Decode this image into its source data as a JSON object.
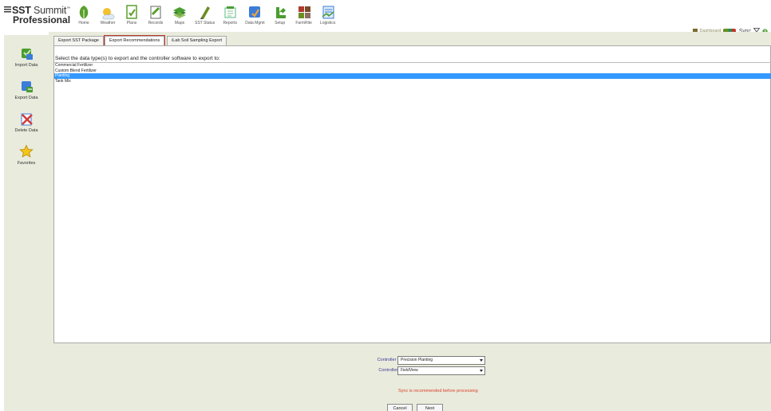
{
  "brand": {
    "line1_bold": "SST",
    "line1_light": " Summit",
    "tm": "™",
    "line2": "Professional"
  },
  "toolbar": [
    {
      "label": "Home",
      "icon": "home-icon",
      "color": "#5aa02c"
    },
    {
      "label": "Weather",
      "icon": "weather-icon",
      "color": "#f2c12e"
    },
    {
      "label": "Plans",
      "icon": "plans-icon",
      "color": "#5aa02c"
    },
    {
      "label": "Records",
      "icon": "records-icon",
      "color": "#5aa02c"
    },
    {
      "label": "Maps",
      "icon": "maps-icon",
      "color": "#4a9d2f"
    },
    {
      "label": "SST Status",
      "icon": "sst-status-icon",
      "color": "#6b8e23"
    },
    {
      "label": "Reports",
      "icon": "reports-icon",
      "color": "#4a9d2f"
    },
    {
      "label": "Data Mgmt",
      "icon": "data-mgmt-icon",
      "color": "#3b7dd8"
    },
    {
      "label": "Setup",
      "icon": "setup-icon",
      "color": "#4a9d2f"
    },
    {
      "label": "FarmRite",
      "icon": "farmrite-icon",
      "color": "#b03a2e"
    },
    {
      "label": "Logistics",
      "icon": "logistics-icon",
      "color": "#3b7dd8"
    }
  ],
  "status": {
    "dashboard_label": "Dashboard",
    "sync_label": "Sync"
  },
  "sidebar": [
    {
      "label": "Import Data",
      "icon": "import-data-icon"
    },
    {
      "label": "Export Data",
      "icon": "export-data-icon"
    },
    {
      "label": "Delete Data",
      "icon": "delete-data-icon"
    },
    {
      "label": "Favorites",
      "icon": "favorites-icon"
    }
  ],
  "tabs": [
    {
      "label": "Export SST Package",
      "active": false
    },
    {
      "label": "Export Recommendations",
      "active": true
    },
    {
      "label": "iLab Soil Sampling Export",
      "active": false
    }
  ],
  "main": {
    "prompt": "Select the data type(s) to export and the controller software to export to:",
    "data_types": [
      {
        "label": "Commercial Fertilizer",
        "selected": false
      },
      {
        "label": "Custom Blend Fertilizer",
        "selected": false
      },
      {
        "label": "Planting",
        "selected": true
      },
      {
        "label": "Tank Mix",
        "selected": false
      }
    ]
  },
  "form": {
    "company_label": "Controller Company:",
    "company_value": "Precision Planting",
    "software_label": "Controller Software:",
    "software_value": "FieldView",
    "warning": "Sync is recommended before processing",
    "cancel_label": "Cancel",
    "next_label": "Next"
  },
  "colors": {
    "panel_bg": "#e9ebdc",
    "selection": "#3399ff",
    "warning": "#d9402b",
    "label": "#3b3b9a",
    "active_tab_outline": "#c0392b"
  }
}
